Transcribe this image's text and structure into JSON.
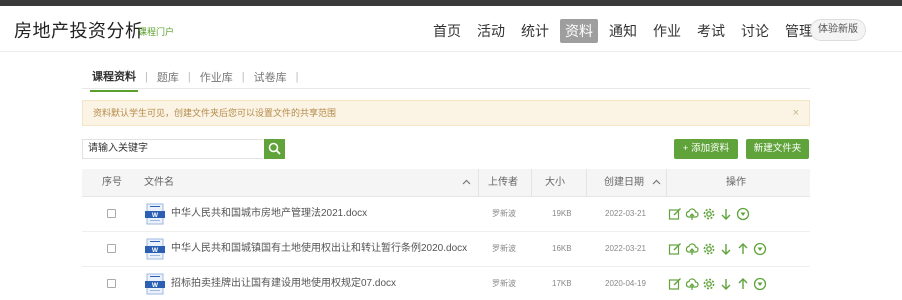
{
  "header": {
    "title": "房地产投资分析",
    "subtitle": "课程门户",
    "nav": [
      "首页",
      "活动",
      "统计",
      "资料",
      "通知",
      "作业",
      "考试",
      "讨论",
      "管理"
    ],
    "active_nav": "资料",
    "trial_label": "体验新版"
  },
  "subtabs": [
    "课程资料",
    "题库",
    "作业库",
    "试卷库"
  ],
  "active_subtab": "课程资料",
  "notice": {
    "text": "资料默认学生可见，创建文件夹后您可以设置文件的共享范围",
    "close": "×"
  },
  "search": {
    "value": "请输入关键字"
  },
  "buttons": {
    "add": "+ 添加资料",
    "new_folder": "新建文件夹"
  },
  "table": {
    "columns": [
      "序号",
      "文件名",
      "上传者",
      "大小",
      "创建日期",
      "操作"
    ],
    "rows": [
      {
        "name": "中华人民共和国城市房地产管理法2021.docx",
        "uploader": "罗新波",
        "size": "19KB",
        "date": "2022-03-21"
      },
      {
        "name": "中华人民共和国城镇国有土地使用权出让和转让暂行条例2020.docx",
        "uploader": "罗新波",
        "size": "16KB",
        "date": "2022-03-21"
      },
      {
        "name": "招标拍卖挂牌出让国有建设用地使用权规定07.docx",
        "uploader": "罗新波",
        "size": "17KB",
        "date": "2020-04-19"
      }
    ]
  },
  "colors": {
    "accent": "#5fa33a",
    "notice_bg": "#fbf4e4",
    "nav_active_bg": "#9e9e9e"
  }
}
